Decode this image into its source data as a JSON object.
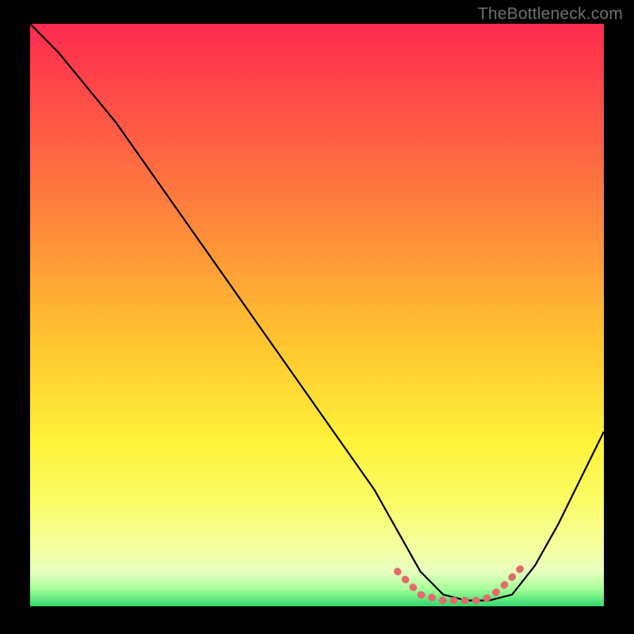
{
  "watermark": "TheBottleneck.com",
  "chart_data": {
    "type": "line",
    "title": "",
    "xlabel": "",
    "ylabel": "",
    "xlim": [
      0,
      100
    ],
    "ylim": [
      0,
      100
    ],
    "background": {
      "type": "vertical-gradient",
      "stops": [
        {
          "offset": 0.0,
          "color": "#ff2a4f"
        },
        {
          "offset": 0.18,
          "color": "#ff5a45"
        },
        {
          "offset": 0.35,
          "color": "#ff8a3a"
        },
        {
          "offset": 0.55,
          "color": "#ffc62f"
        },
        {
          "offset": 0.72,
          "color": "#fff23a"
        },
        {
          "offset": 0.82,
          "color": "#fafc66"
        },
        {
          "offset": 0.9,
          "color": "#f6ffa0"
        },
        {
          "offset": 0.94,
          "color": "#e8ffc0"
        },
        {
          "offset": 0.97,
          "color": "#a8ff9a"
        },
        {
          "offset": 1.0,
          "color": "#2fd96b"
        }
      ]
    },
    "series": [
      {
        "name": "bottleneck-curve",
        "color": "#000000",
        "x": [
          0,
          5,
          10,
          15,
          20,
          25,
          30,
          35,
          40,
          45,
          50,
          55,
          60,
          64,
          68,
          72,
          76,
          80,
          84,
          88,
          92,
          96,
          100
        ],
        "values": [
          100,
          95,
          89,
          83,
          76,
          69,
          62,
          55,
          48,
          41,
          34,
          27,
          20,
          13,
          6,
          2,
          1,
          1,
          2,
          7,
          14,
          22,
          30
        ]
      }
    ],
    "highlight": {
      "name": "optimal-range",
      "color": "#e26a6a",
      "x": [
        64,
        66,
        68,
        70,
        72,
        74,
        76,
        78,
        80,
        82,
        84,
        86
      ],
      "values": [
        6,
        4,
        2,
        1.5,
        1,
        1,
        1,
        1,
        1.5,
        3,
        5,
        7
      ]
    }
  }
}
